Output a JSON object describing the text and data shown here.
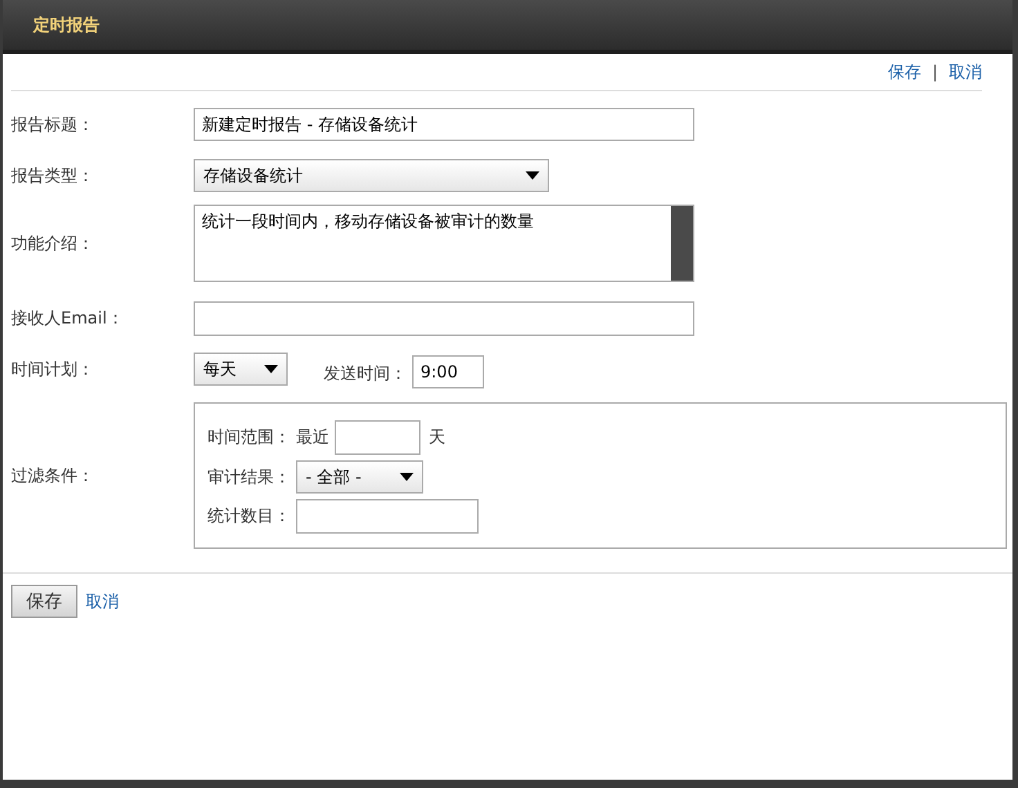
{
  "window": {
    "title": "定时报告"
  },
  "top_actions": {
    "links": [
      "保存",
      "取消"
    ],
    "separator": "|"
  },
  "form": {
    "title_label": "报告标题：",
    "title_value": "新建定时报告 - 存储设备统计",
    "type_label": "报告类型：",
    "type_value": "存储设备统计",
    "intro_label": "功能介绍：",
    "intro_value": "统计一段时间内，移动存储设备被审计的数量",
    "email_label": "接收人Email：",
    "schedule_label": "时间计划：",
    "schedule_value": "每天",
    "send_time_label": "发送时间：",
    "send_time_value": "9:00",
    "filter_label": "过滤条件：",
    "filter": {
      "range_label": "时间范围：",
      "range_prefix": "最近",
      "range_unit": "天",
      "result_label": "审计结果：",
      "result_value": "- 全部 -",
      "count_label": "统计数目："
    }
  },
  "bottom_actions": {
    "save": "保存",
    "cancel": "取消"
  }
}
